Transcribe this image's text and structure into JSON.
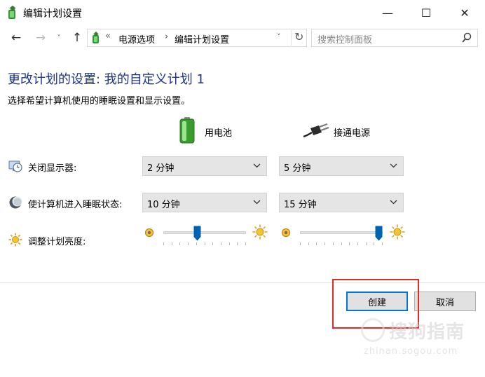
{
  "window": {
    "title": "编辑计划设置",
    "controls": {
      "minimize": "—",
      "maximize": "☐",
      "close": "✕"
    }
  },
  "nav": {
    "back_glyph": "←",
    "forward_glyph": "→",
    "recent_glyph": "˅",
    "up_glyph": "↑",
    "address": {
      "separator": "«",
      "crumbs": [
        "电源选项",
        "编辑计划设置"
      ],
      "crumb_separator": "›",
      "dropdown_glyph": "˅",
      "refresh_glyph": "↻"
    },
    "search": {
      "placeholder": "搜索控制面板"
    }
  },
  "main": {
    "title": "更改计划的设置: 我的自定义计划 1",
    "description": "选择希望计算机使用的睡眠设置和显示设置。",
    "columns": [
      {
        "label": "用电池",
        "icon": "battery-icon"
      },
      {
        "label": "接通电源",
        "icon": "power-plug-icon"
      }
    ],
    "rows": {
      "display_off": {
        "label": "关闭显示器:",
        "icon": "monitor-clock-icon",
        "battery_value": "2 分钟",
        "plugged_value": "5 分钟"
      },
      "sleep": {
        "label": "使计算机进入睡眠状态:",
        "icon": "moon-icon",
        "battery_value": "10 分钟",
        "plugged_value": "15 分钟"
      },
      "brightness": {
        "label": "调整计划亮度:",
        "icon": "sun-icon",
        "battery_level_percent": 40,
        "plugged_level_percent": 100
      }
    }
  },
  "buttons": {
    "create": "创建",
    "cancel": "取消"
  },
  "watermark": {
    "text": "搜狗指南",
    "url": "zhinan.sogou.com"
  },
  "colors": {
    "title_blue": "#1e3287",
    "accent": "#0078d7",
    "highlight_red": "#e52929",
    "slider_thumb": "#0063b1"
  }
}
